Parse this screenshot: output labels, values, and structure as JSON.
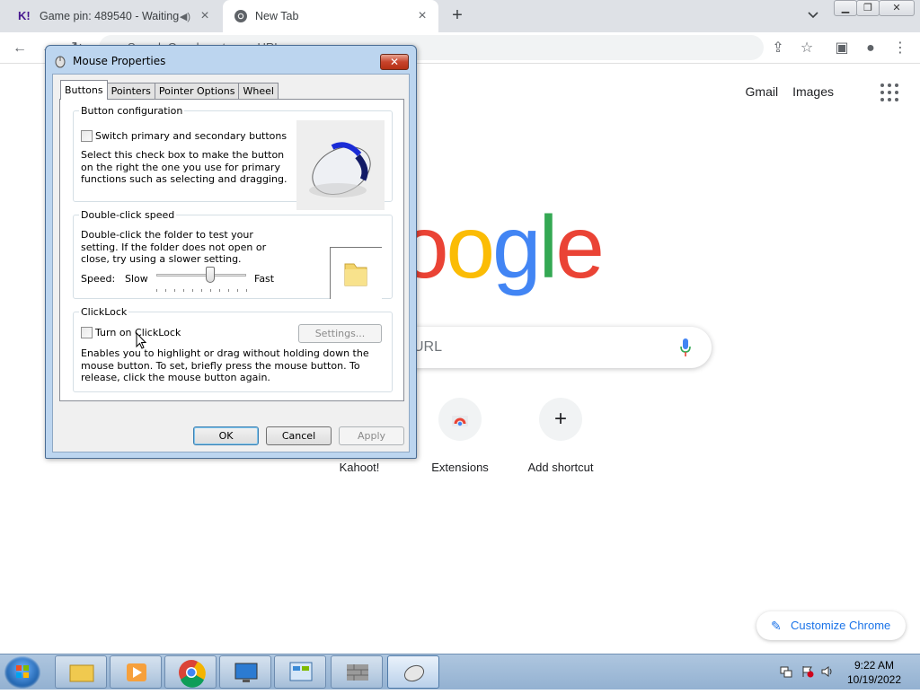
{
  "browser": {
    "tabs": [
      {
        "title": "Game pin: 489540 - Waiting",
        "favicon": "kahoot-icon",
        "audio": true
      },
      {
        "title": "New Tab",
        "favicon": "chrome-icon"
      }
    ],
    "omnibox_placeholder": "Search Google or type a URL"
  },
  "ntp": {
    "links": [
      "Gmail",
      "Images"
    ],
    "logo_letters": [
      "o",
      "o",
      "g",
      "l",
      "e"
    ],
    "logo_colors": [
      "#ea4335",
      "#fbbc05",
      "#4285f4",
      "#34a853",
      "#ea4335"
    ],
    "search_visible_text": "URL",
    "shortcuts": [
      "Kahoot!",
      "Extensions",
      "Add shortcut"
    ],
    "customize_label": "Customize Chrome"
  },
  "dialog": {
    "title": "Mouse Properties",
    "tabs": [
      "Buttons",
      "Pointers",
      "Pointer Options",
      "Wheel"
    ],
    "selected_tab": "Buttons",
    "button_config": {
      "legend": "Button configuration",
      "checkbox_label": "Switch primary and secondary buttons",
      "checked": false,
      "description": "Select this check box to make the button on the right the one you use for primary functions such as selecting and dragging."
    },
    "double_click": {
      "legend": "Double-click speed",
      "description": "Double-click the folder to test your setting. If the folder does not open or close, try using a slower setting.",
      "speed_label": "Speed:",
      "slow_label": "Slow",
      "fast_label": "Fast",
      "slider_level": 0.6
    },
    "clicklock": {
      "legend": "ClickLock",
      "checkbox_label": "Turn on ClickLock",
      "checked": false,
      "settings_label": "Settings...",
      "description": "Enables you to highlight or drag without holding down the mouse button. To set, briefly press the mouse button. To release, click the mouse button again."
    },
    "buttons": {
      "ok": "OK",
      "cancel": "Cancel",
      "apply": "Apply"
    }
  },
  "taskbar": {
    "time": "9:22 AM",
    "date": "10/19/2022"
  }
}
